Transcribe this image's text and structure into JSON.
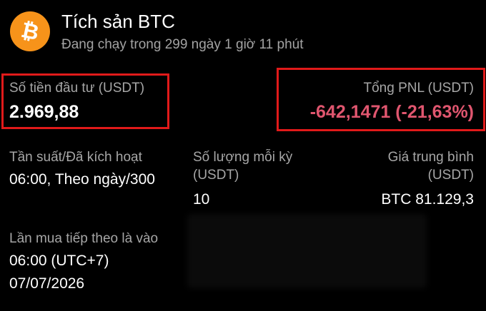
{
  "header": {
    "title": "Tích sản BTC",
    "subtitle": "Đang chạy trong 299 ngày 1 giờ 11 phút",
    "icon": "bitcoin-icon",
    "icon_color": "#f7931a"
  },
  "invest": {
    "label": "Số tiền đầu tư (USDT)",
    "value": "2.969,88"
  },
  "pnl": {
    "label": "Tổng PNL (USDT)",
    "value": "-642,1471 (-21,63%)",
    "color": "#e0566f"
  },
  "frequency": {
    "label": "Tần suất/Đã kích hoạt",
    "value": "06:00, Theo ngày/300"
  },
  "amount_per_period": {
    "label_line1": "Số lượng mỗi kỳ",
    "label_line2": "(USDT)",
    "value": "10"
  },
  "average_price": {
    "label_line1": "Giá trung bình",
    "label_line2": "(USDT)",
    "value": "BTC 81.129,3"
  },
  "next_buy": {
    "label": "Lần mua tiếp theo là vào",
    "time": "06:00 (UTC+7)",
    "date": "07/07/2026"
  },
  "highlight_color": "#e11a1a"
}
